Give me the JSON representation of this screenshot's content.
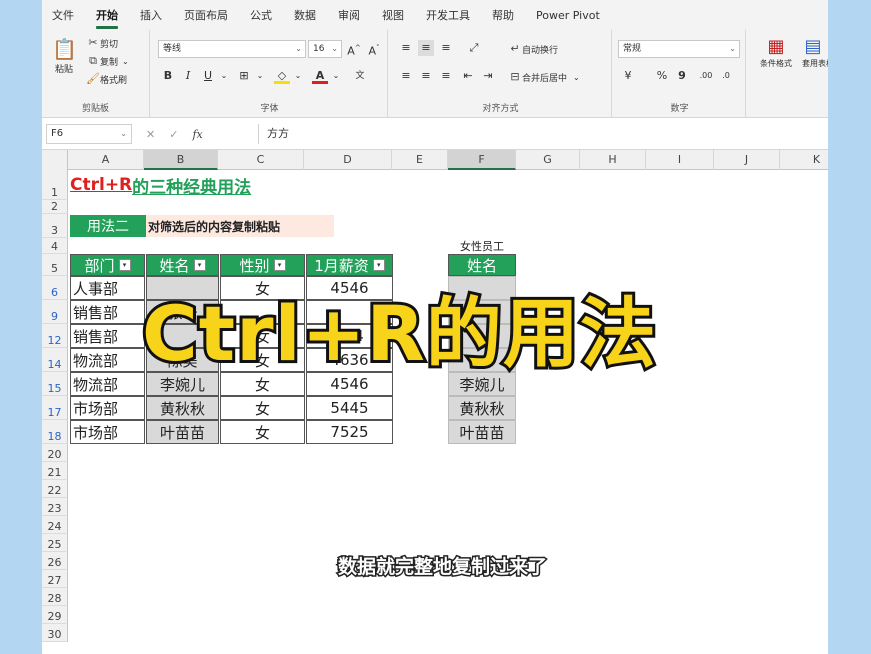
{
  "menu": [
    "文件",
    "开始",
    "插入",
    "页面布局",
    "公式",
    "数据",
    "审阅",
    "视图",
    "开发工具",
    "帮助",
    "Power Pivot"
  ],
  "menu_active_index": 1,
  "ribbon": {
    "clipboard": {
      "paste": "粘贴",
      "cut": "剪切",
      "copy": "复制",
      "format_painter": "格式刷",
      "label": "剪贴板"
    },
    "font": {
      "name": "等线",
      "size": "16",
      "bold": "B",
      "italic": "I",
      "underline": "U",
      "grow": "A^",
      "shrink": "A˅",
      "label": "字体"
    },
    "align": {
      "wrap": "自动换行",
      "merge": "合并后居中",
      "label": "对齐方式"
    },
    "number": {
      "format": "常规",
      "percent": "%",
      "comma": "9",
      "label": "数字"
    },
    "styles": {
      "conditional": "条件格式",
      "table": "套用表格格式"
    }
  },
  "formula_bar": {
    "name_box": "F6",
    "cancel": "✕",
    "confirm": "✓",
    "fx": "fx",
    "content": "方方"
  },
  "columns": [
    "A",
    "B",
    "C",
    "D",
    "E",
    "F",
    "G",
    "H",
    "I",
    "J",
    "K"
  ],
  "rows": [
    "1",
    "2",
    "3",
    "4",
    "5",
    "6",
    "9",
    "12",
    "14",
    "15",
    "17",
    "18",
    "20",
    "21",
    "22",
    "23",
    "24",
    "25",
    "26",
    "27",
    "28",
    "29",
    "30"
  ],
  "sheet": {
    "title_red": "Ctrl+R",
    "title_green": "的三种经典用法",
    "method_label": "用法二",
    "method_desc": "对筛选后的内容复制粘贴",
    "headers": [
      "部门",
      "姓名",
      "性别",
      "1月薪资"
    ],
    "table_rows": [
      [
        "人事部",
        "",
        "女",
        "4546"
      ],
      [
        "销售部",
        "张珊",
        "",
        ""
      ],
      [
        "销售部",
        "",
        "女",
        "554"
      ],
      [
        "物流部",
        "陈美",
        "女",
        "4636"
      ],
      [
        "物流部",
        "李婉儿",
        "女",
        "4546"
      ],
      [
        "市场部",
        "黄秋秋",
        "女",
        "5445"
      ],
      [
        "市场部",
        "叶苗苗",
        "女",
        "7525"
      ]
    ],
    "right_caption": "女性员工",
    "right_header": "姓名",
    "right_values": [
      "",
      "",
      "",
      "",
      "李婉儿",
      "黄秋秋",
      "叶苗苗"
    ]
  },
  "overlay": {
    "big_title": "Ctrl+R的用法",
    "subtitle": "数据就完整地复制过来了"
  },
  "colors": {
    "accent": "#217346",
    "header_green": "#23a05a",
    "title_red": "#e02020",
    "title_green": "#23a05a",
    "overlay_yellow": "#f7d31a"
  }
}
